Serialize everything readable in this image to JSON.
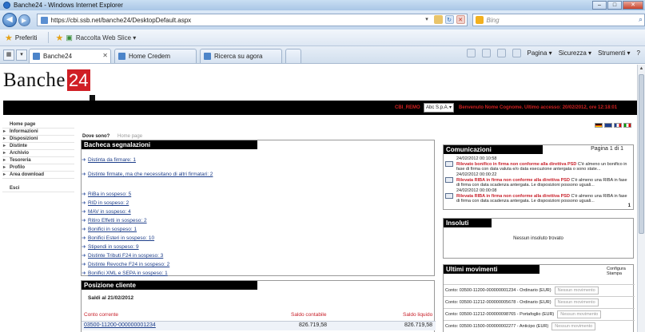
{
  "browser": {
    "window_title": "Banche24 - Windows Internet Explorer",
    "url": "https://cbi.ssb.net/banche24/DesktopDefault.aspx",
    "search_placeholder": "Bing",
    "favorites_label": "Preferiti",
    "web_slice_label": "Raccolta Web Slice ▾",
    "tabs": [
      {
        "label": "Banche24",
        "active": true
      },
      {
        "label": "Home Credem",
        "active": false
      },
      {
        "label": "Ricerca su agora",
        "active": false
      }
    ],
    "commands": {
      "page": "Pagina ▾",
      "security": "Sicurezza ▾",
      "tools": "Strumenti ▾",
      "help": "?"
    }
  },
  "site": {
    "logo_word": "Banche",
    "logo_number": "24",
    "user_label": "CBI_REMO",
    "company_select": "Abc S.p.A.",
    "welcome_text": "Benvenuto Nome Cognome. Ultimo accesso: 20/02/2012, ore 12:18:01"
  },
  "side_menu": [
    {
      "label": "Home page",
      "has_arrow": false
    },
    {
      "label": "Informazioni",
      "has_arrow": true
    },
    {
      "label": "Disposizioni",
      "has_arrow": true
    },
    {
      "label": "Distinte",
      "has_arrow": true
    },
    {
      "label": "Archivio",
      "has_arrow": true
    },
    {
      "label": "Tesoreria",
      "has_arrow": true
    },
    {
      "label": "Profilo",
      "has_arrow": true
    },
    {
      "label": "Area download",
      "has_arrow": true
    },
    {
      "label": "Esci",
      "has_arrow": false
    }
  ],
  "breadcrumb": {
    "label": "Dove sono?",
    "current": "Home page"
  },
  "bacheca": {
    "title": "Bacheca segnalazioni",
    "links": [
      "Distinta da firmare: 1",
      "Distinte firmate, ma che necessitano di altri firmatari: 2",
      "RiBa in sospeso: 5",
      "RID in sospeso: 2",
      "MAV in sospeso: 4",
      "Ritiro Effetti in sospeso: 2",
      "Bonifici in sospeso: 1",
      "Bonifici Esteri in sospeso: 10",
      "Stipendi in sospeso: 9",
      "Distinte Tributi F24 in sospeso: 3",
      "Distinte Revoche F24 in sospeso: 2",
      "Bonifici XML e SEPA in sospeso: 1"
    ]
  },
  "posizione": {
    "title": "Posizione cliente",
    "saldi_label": "Saldi al 21/02/2012",
    "col_conto": "Conto corrente",
    "col_contabile": "Saldo contabile",
    "col_liquido": "Saldo liquido",
    "row": {
      "conto": "03500-11200-000000001234",
      "contabile": "826.719,58",
      "liquido": "826.719,58"
    }
  },
  "comunicazioni": {
    "title": "Comunicazioni",
    "page_label": "Pagina 1 di 1",
    "count": "1",
    "messages": [
      {
        "date": "24/02/2012 00:10:58",
        "subject": "Rilevato bonifico in firma non conforme alla direttiva PSD",
        "text": "C'è almeno un bonifico in fase di firma con data valuta e/o data esecuzione antergata o sono state..."
      },
      {
        "date": "24/02/2012 00:00:22",
        "subject": "Rilevata RIBA in firma non conforme alla direttiva PSD",
        "text": "C'è almeno una RIBA in fase di firma con data scadenza antergata. Le disposizioni possono uguali..."
      },
      {
        "date": "24/02/2012 00:00:08",
        "subject": "Rilevata RIBA in firma non conforme alla direttiva PSD",
        "text": "C'è almeno una RIBA in fase di firma con data scadenza antergata. Le disposizioni possono uguali..."
      }
    ]
  },
  "insoluti": {
    "title": "Insoluti",
    "empty_text": "Nessun insoluto trovato"
  },
  "movimenti": {
    "title": "Ultimi movimenti",
    "configure": "Configura",
    "print": "Stampa",
    "rows": [
      {
        "conto": "Conto: 03500-11200-000000001234 - Ordinario (EUR)",
        "status": "Nessun movimento"
      },
      {
        "conto": "Conto: 03500-11212-000000005678 - Ordinario (EUR)",
        "status": "Nessun movimento"
      },
      {
        "conto": "Conto: 03500-11212-000000098765 - Portafoglio (EUR)",
        "status": "Nessun movimento"
      },
      {
        "conto": "Conto: 03500-11500-000000002277 - Anticipo (EUR)",
        "status": "Nessun movimento"
      }
    ]
  },
  "colors": {
    "brand_red": "#d01f25",
    "link_blue": "#1d3e8a",
    "header_black": "#000000"
  }
}
